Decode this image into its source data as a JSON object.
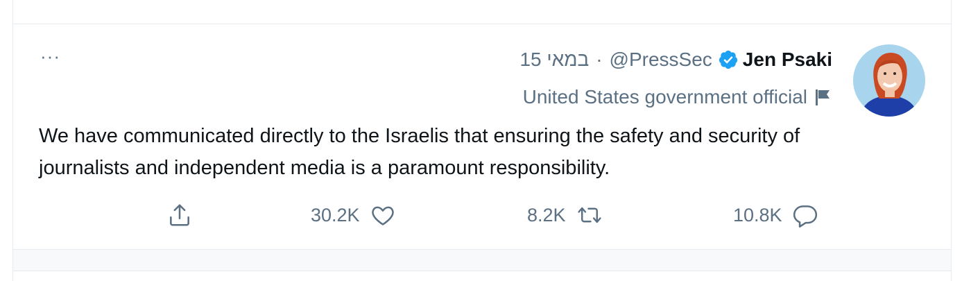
{
  "tweet": {
    "author_name": "Jen Psaki",
    "handle": "@PressSec",
    "separator": "·",
    "date": "15 במאי",
    "label": "United States government official",
    "text": "We have communicated directly to the Israelis that ensuring the safety and security of journalists and independent media is a paramount responsibility.",
    "more_glyph": "···",
    "verified": true,
    "icons": {
      "more": "more-icon",
      "verified": "verified-badge-icon",
      "flag": "flag-icon",
      "reply": "reply-icon",
      "retweet": "retweet-icon",
      "like": "like-icon",
      "share": "share-icon"
    }
  },
  "actions": {
    "reply_count": "10.8K",
    "retweet_count": "8.2K",
    "like_count": "30.2K"
  },
  "colors": {
    "accent": "#1da1f2",
    "secondary_text": "#5b7083",
    "primary_text": "#0f1419",
    "border": "#e6ecf0"
  }
}
